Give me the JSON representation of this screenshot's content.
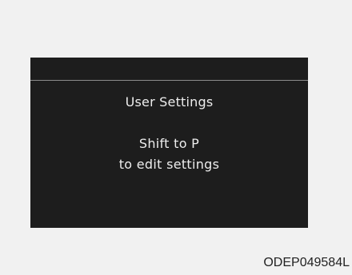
{
  "display": {
    "title": "User Settings",
    "message_line1": "Shift to P",
    "message_line2": "to edit settings"
  },
  "figure_code": "ODEP049584L"
}
